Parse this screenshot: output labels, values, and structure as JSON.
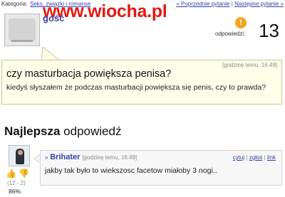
{
  "topbar": {
    "category_label": "Kategoria:",
    "category_link": "Seks, związki i romanse",
    "prev_link": "« Poprzednie pytanie",
    "separator": "|",
    "next_link": "Następne pytanie »"
  },
  "watermark": "www.wiocha.pl",
  "question": {
    "asker": "gość",
    "time": "[godzinę temu, 16:49]",
    "title": "czy masturbacja powiększa penisa?",
    "body": "kiedyś słyszałem że podczas masturbacji powiększa się penis, czy to prawda?"
  },
  "answers_count": {
    "badge": "!",
    "label": "odpowiedzi:",
    "value": "13"
  },
  "best_answer": {
    "heading_bold": "Najlepsza",
    "heading_rest": " odpowiedź",
    "chevron": "»",
    "user": "Brihater",
    "time": "[godzinę temu, 16:49]",
    "actions": {
      "quote": "cytuj",
      "report": "zgłoś",
      "link": "link",
      "sep": "|"
    },
    "body": "jakby tak było to wiekszosc facetow miałoby 3 nogi..",
    "votes": {
      "tally": "(12 - 2)",
      "percent": "86%"
    }
  },
  "colors": {
    "link": "#3344aa",
    "watermark": "#e21a12",
    "question_bg": "#ffffea",
    "badge": "#f4a51c"
  },
  "icons": {
    "thumb_up": "thumb-up-icon",
    "thumb_down": "thumb-down-icon",
    "alert": "exclamation-badge-icon"
  }
}
